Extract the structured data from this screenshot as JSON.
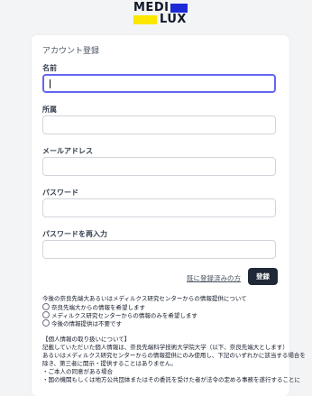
{
  "logo": {
    "line1": "MEDI",
    "line2": "LUX"
  },
  "form": {
    "title": "アカウント登録",
    "name_label": "名前",
    "affiliation_label": "所属",
    "email_label": "メールアドレス",
    "password_label": "パスワード",
    "password_confirm_label": "パスワードを再入力",
    "already_registered_link": "既に登録済みの方",
    "register_button": "登録"
  },
  "info_question": "今後の奈良先端大あるいはメディルクス研究センターからの情報提供について",
  "info_options": [
    "奈良先端大からの情報を希望します",
    "メディルクス研究センターからの情報のみを希望します",
    "今後の情報提供は不要です"
  ],
  "privacy": {
    "heading": "【個人情報の取り扱いについて】",
    "lines": [
      "記載していただいた個人情報は、奈良先端科学技術大学院大学（以下、奈良先端大とします）",
      "あるいはメディルクス研究センターからの情報提供にのみ使用し、下記のいずれかに該当する場合を",
      "除き、第三者に開示・提供することはありません。",
      "・ご本人の同意がある場合",
      "・国の機関もしくは地方公共団体またはその委託を受けた者が法令の定める事務を遂行することに"
    ]
  },
  "colors": {
    "focus": "#6366f1",
    "button_bg": "#1f2937",
    "logo_blue": "#1d2ad6",
    "logo_yellow": "#fde600"
  }
}
